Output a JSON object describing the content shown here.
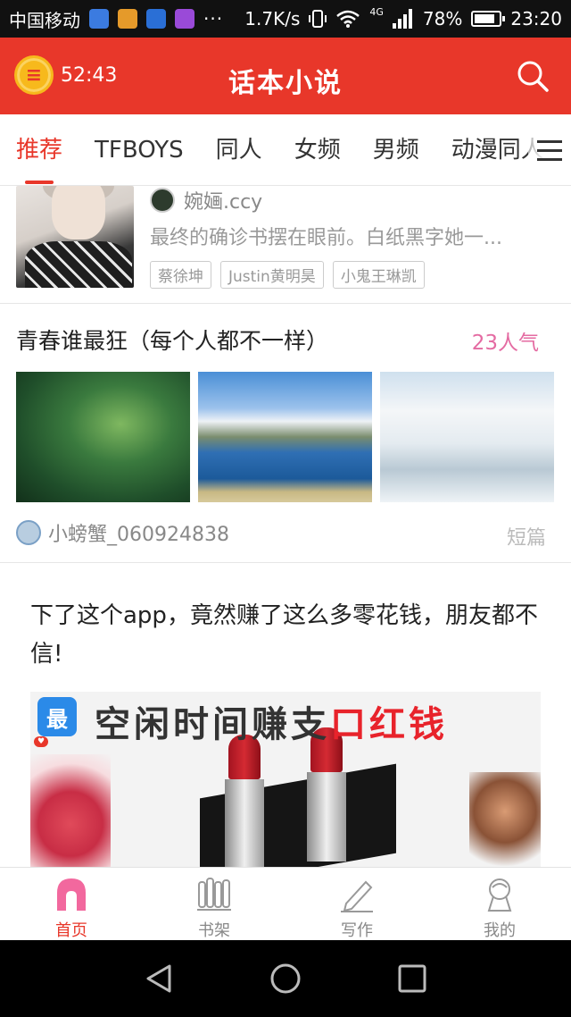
{
  "status_bar": {
    "carrier": "中国移动",
    "dots": "···",
    "speed": "1.7K/s",
    "network": "4G",
    "battery": "78%",
    "time": "23:20"
  },
  "header": {
    "timer": "52:43",
    "title": "话本小说",
    "search_icon": "search-icon",
    "timer_icon": "alarm-clock-icon"
  },
  "tabs": [
    "推荐",
    "TFBOYS",
    "同人",
    "女频",
    "男频",
    "动漫同人"
  ],
  "book": {
    "author": "婉婳.ccy",
    "description": "最终的确诊书摆在眼前。白纸黑字她一...",
    "tags": [
      "蔡徐坤",
      "Justin黄明昊",
      "小鬼王琳凯"
    ]
  },
  "booklist": {
    "title": "青春谁最狂（每个人都不一样）",
    "popularity": "23人气",
    "user": "小螃蟹_060924838",
    "type": "短篇"
  },
  "ad": {
    "text": "下了这个app，竟然赚了这么多零花钱，朋友都不信!",
    "badge": "最",
    "headline_a": "空闲时间赚支",
    "headline_b": "口红钱"
  },
  "bottom_nav": [
    {
      "label": "首页",
      "icon": "home-icon"
    },
    {
      "label": "书架",
      "icon": "bookshelf-icon"
    },
    {
      "label": "写作",
      "icon": "pen-icon"
    },
    {
      "label": "我的",
      "icon": "profile-icon"
    }
  ],
  "colors": {
    "accent": "#e8372a",
    "popularity": "#e46ba2"
  }
}
